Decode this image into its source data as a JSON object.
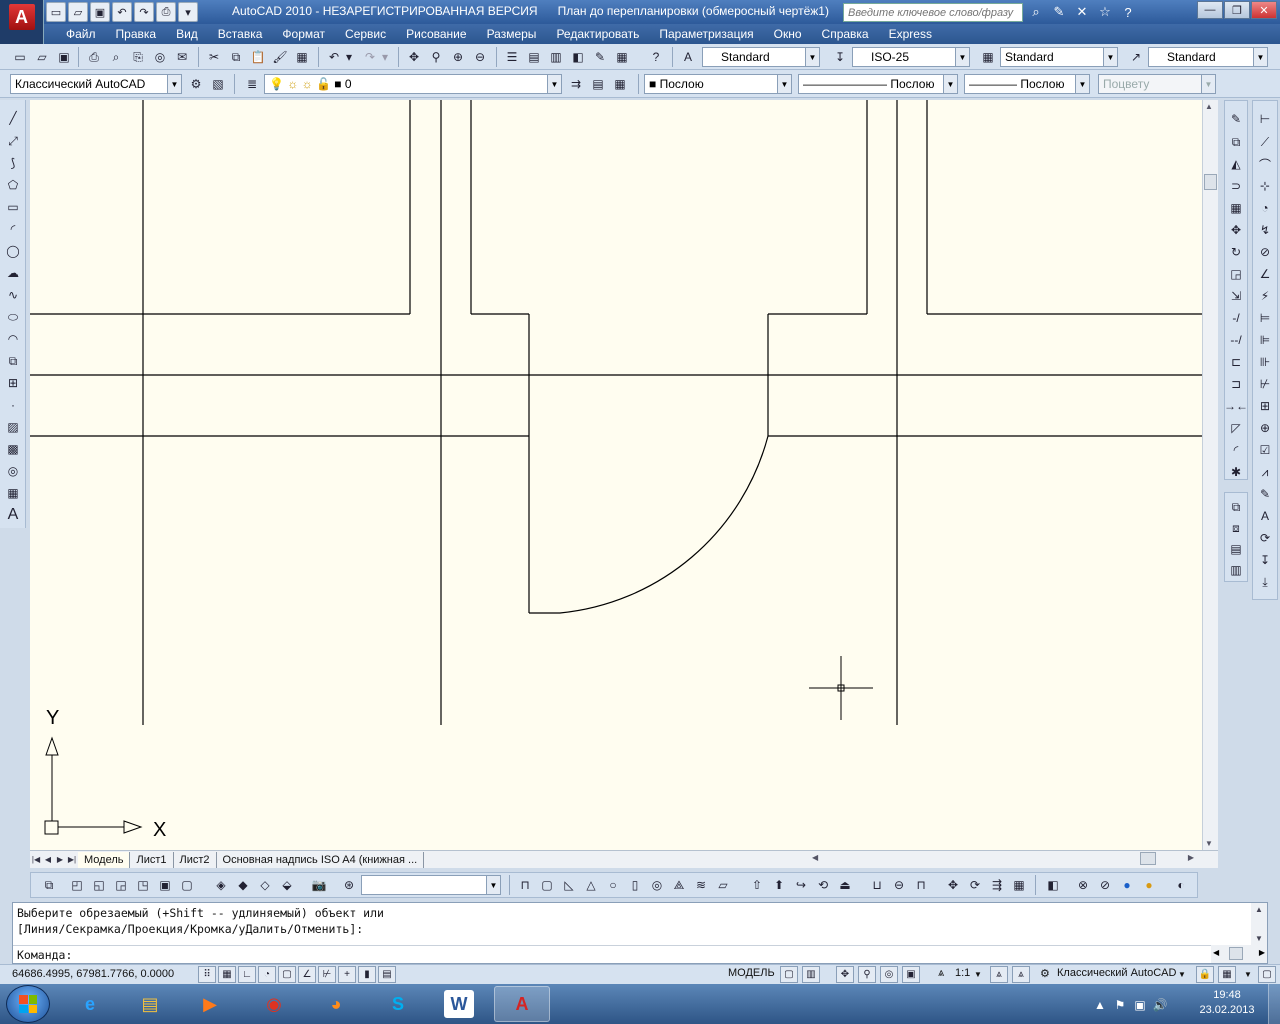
{
  "app": {
    "logo_letter": "A",
    "title_app": "AutoCAD 2010 - НЕЗАРЕГИСТРИРОВАННАЯ ВЕРСИЯ",
    "title_doc": "План до перепланировки (обмеросный чертёж1).d",
    "search_placeholder": "Введите ключевое слово/фразу"
  },
  "menu": [
    "Файл",
    "Правка",
    "Вид",
    "Вставка",
    "Формат",
    "Сервис",
    "Рисование",
    "Размеры",
    "Редактировать",
    "Параметризация",
    "Окно",
    "Справка",
    "Express"
  ],
  "toolbar1": {
    "text_style": "Standard",
    "dim_style": "ISO-25",
    "table_style": "Standard",
    "mleader_style": "Standard"
  },
  "toolbar2": {
    "workspace": "Классический AutoCAD",
    "layer": "0",
    "color": "Послою",
    "linetype": "Послою",
    "lineweight": "Послою",
    "plotstyle": "Поцвету"
  },
  "ucs": {
    "x_label": "X",
    "y_label": "Y"
  },
  "layout_tabs": [
    "Модель",
    "Лист1",
    "Лист2",
    "Основная надпись ISO A4 (книжная ..."
  ],
  "command": {
    "line1": "Выберите обрезаемый (+Shift -- удлиняемый) объект или",
    "line2": "[Линия/Секрамка/Проекция/Кромка/уДалить/Отменить]:",
    "prompt": "Команда:"
  },
  "status": {
    "coords": "64686.4995, 67981.7766, 0.0000",
    "model": "МОДЕЛЬ",
    "scale": "1:1",
    "workspace": "Классический AutoCAD"
  },
  "clock": {
    "time": "19:48",
    "date": "23.02.2013"
  },
  "colors": {
    "canvas": "#fffdf0",
    "title": "#2d5a9a",
    "autocad_red": "#d42424"
  }
}
